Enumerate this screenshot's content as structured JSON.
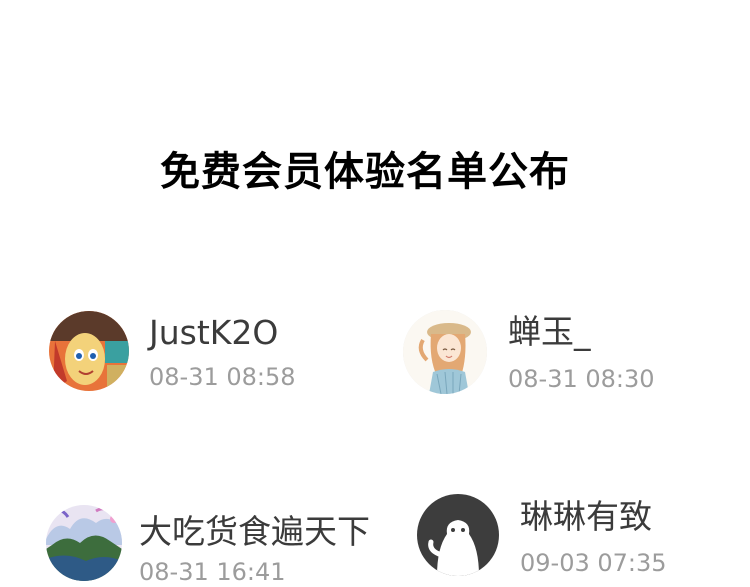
{
  "title": "免费会员体验名单公布",
  "winners": [
    {
      "name": "JustK2O",
      "time": "08-31 08:58",
      "avatar_icon": "anime-character-avatar"
    },
    {
      "name": "蝉玉_",
      "time": "08-31 08:30",
      "avatar_icon": "girl-with-hat-avatar"
    },
    {
      "name": "大吃货食遍天下",
      "time": "08-31 16:41",
      "avatar_icon": "mountain-landscape-avatar"
    },
    {
      "name": "琳琳有致",
      "time": "09-03 07:35",
      "avatar_icon": "default-user-avatar"
    }
  ],
  "colors": {
    "title": "#000000",
    "username": "#3b3b3b",
    "timestamp": "#9c9c9c",
    "background": "#ffffff",
    "default_avatar_bg": "#3d3d3d"
  }
}
